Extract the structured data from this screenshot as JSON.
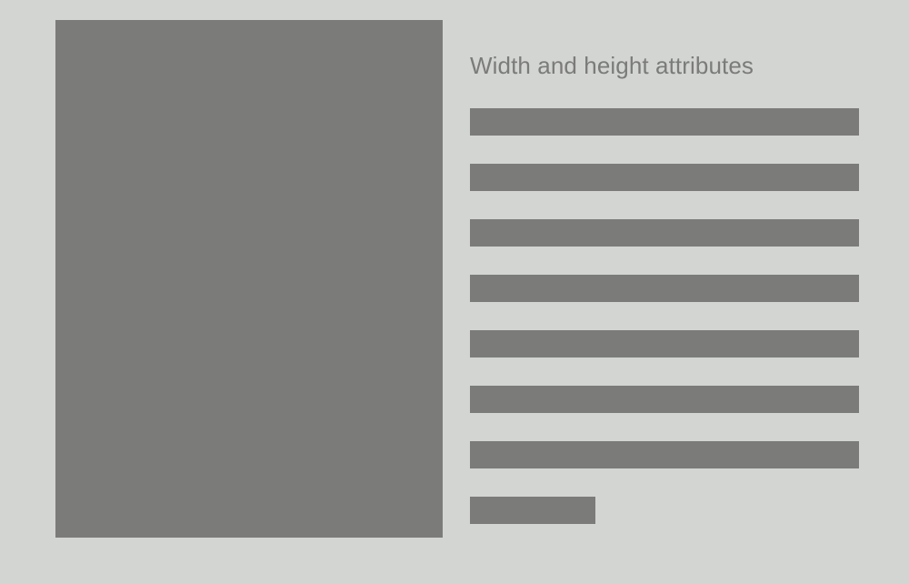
{
  "colors": {
    "background": "#d3d5d2",
    "placeholder": "#7b7c79",
    "heading": "#7b7c79"
  },
  "content": {
    "heading": "Width and height attributes",
    "placeholder_line_count": 8
  }
}
